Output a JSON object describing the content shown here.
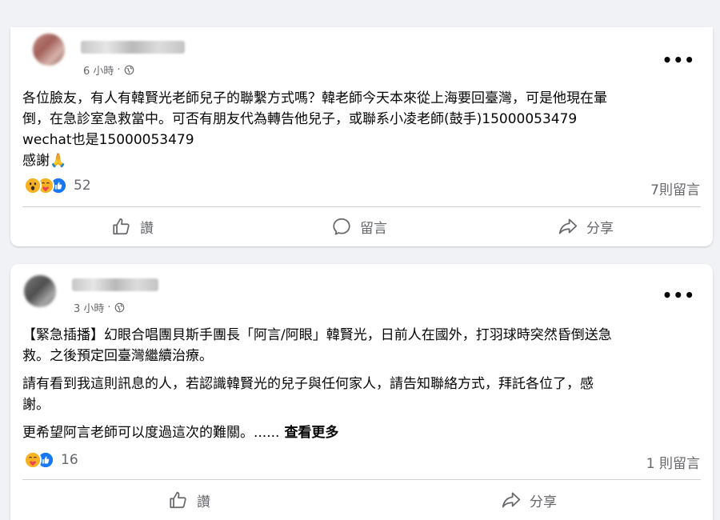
{
  "posts": [
    {
      "time": "6 小時",
      "dot": "·",
      "more": "•••",
      "lines": [
        "各位臉友，有人有韓賢光老師兒子的聯繫方式嗎？韓老師今天本來從上海要回臺灣，可是他現在暈",
        "倒，在急診室急救當中。可否有朋友代為轉告他兒子，或聯系小凌老師(鼓手)15000053479",
        "wechat也是15000053479",
        "感謝🙏"
      ],
      "reaction_icons": [
        "wow-icon",
        "care-icon",
        "like-icon"
      ],
      "reaction_count": "52",
      "comment_count": "7則留言",
      "actions": {
        "like": "讚",
        "comment": "留言",
        "share": "分享"
      }
    },
    {
      "time": "3 小時",
      "dot": "·",
      "more": "•••",
      "paragraphs": [
        [
          "【緊急插播】幻眼合唱團貝斯手團長「阿言/阿眼」韓賢光，日前人在國外，打羽球時突然昏倒送急",
          "救。之後預定回臺灣繼續治療。"
        ],
        [
          "請有看到我這則訊息的人，若認識韓賢光的兒子與任何家人，請告知聯絡方式，拜託各位了，感",
          "謝。"
        ],
        [
          "更希望阿言老師可以度過這次的難關。......"
        ]
      ],
      "see_more": "查看更多",
      "reaction_icons": [
        "care-icon",
        "like-icon"
      ],
      "reaction_count": "16",
      "comment_count": "1 則留言",
      "actions": {
        "like": "讚",
        "share": "分享"
      }
    }
  ],
  "colors": {
    "like_blue": "#1877f2",
    "care_yellow": "#f7b125",
    "secondary_text": "#65676b"
  }
}
